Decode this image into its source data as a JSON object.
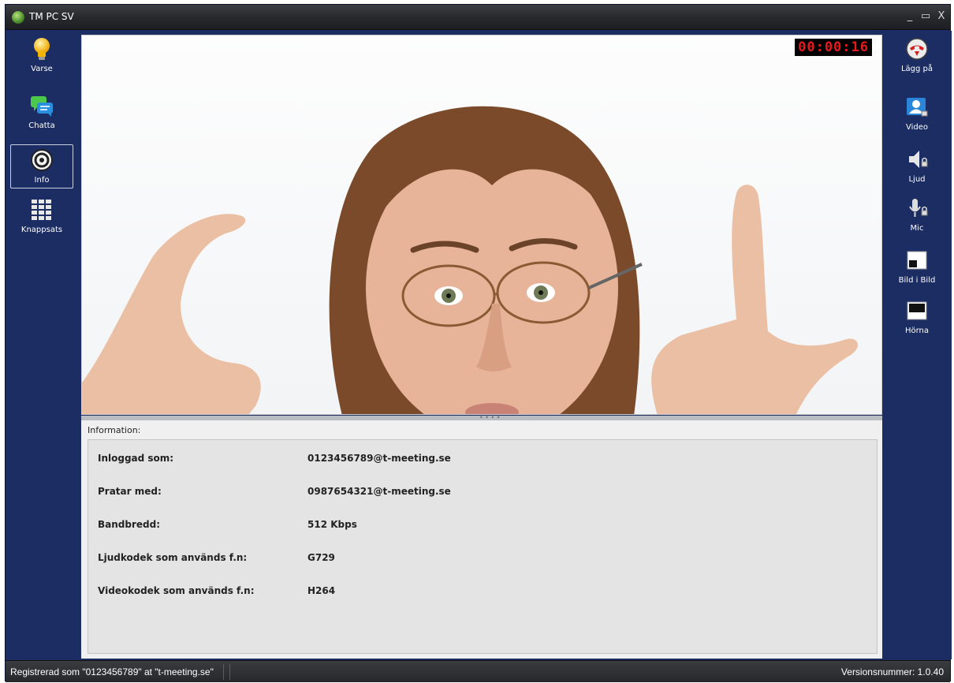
{
  "window": {
    "title": "TM PC SV",
    "minimize": "_",
    "maximize": "▭",
    "close": "X"
  },
  "left_tools": [
    {
      "label": "Varse",
      "icon": "lightbulb-icon"
    },
    {
      "label": "Chatta",
      "icon": "chat-icon"
    },
    {
      "label": "Info",
      "icon": "info-icon",
      "selected": true
    },
    {
      "label": "Knappsats",
      "icon": "keypad-icon"
    }
  ],
  "right_tools": [
    {
      "label": "Lägg på",
      "icon": "hangup-icon"
    },
    {
      "label": "Video",
      "icon": "video-icon"
    },
    {
      "label": "Ljud",
      "icon": "speaker-icon"
    },
    {
      "label": "Mic",
      "icon": "microphone-icon"
    },
    {
      "label": "Bild i Bild",
      "icon": "picture-in-picture-icon"
    },
    {
      "label": "Hörna",
      "icon": "corner-icon"
    }
  ],
  "call": {
    "timer": "00:00:16"
  },
  "info": {
    "header": "Information:",
    "rows": [
      {
        "label": "Inloggad som:",
        "value": "0123456789@t-meeting.se"
      },
      {
        "label": "Pratar med:",
        "value": "0987654321@t-meeting.se"
      },
      {
        "label": "Bandbredd:",
        "value": "512 Kbps"
      },
      {
        "label": "Ljudkodek som används f.n:",
        "value": "G729"
      },
      {
        "label": "Videokodek som används f.n:",
        "value": "H264"
      }
    ]
  },
  "status": {
    "left": "Registrerad som \"0123456789\" at \"t-meeting.se\"",
    "right": "Versionsnummer: 1.0.40"
  },
  "colors": {
    "panel": "#1c2d63",
    "timer": "#e51b1b"
  }
}
